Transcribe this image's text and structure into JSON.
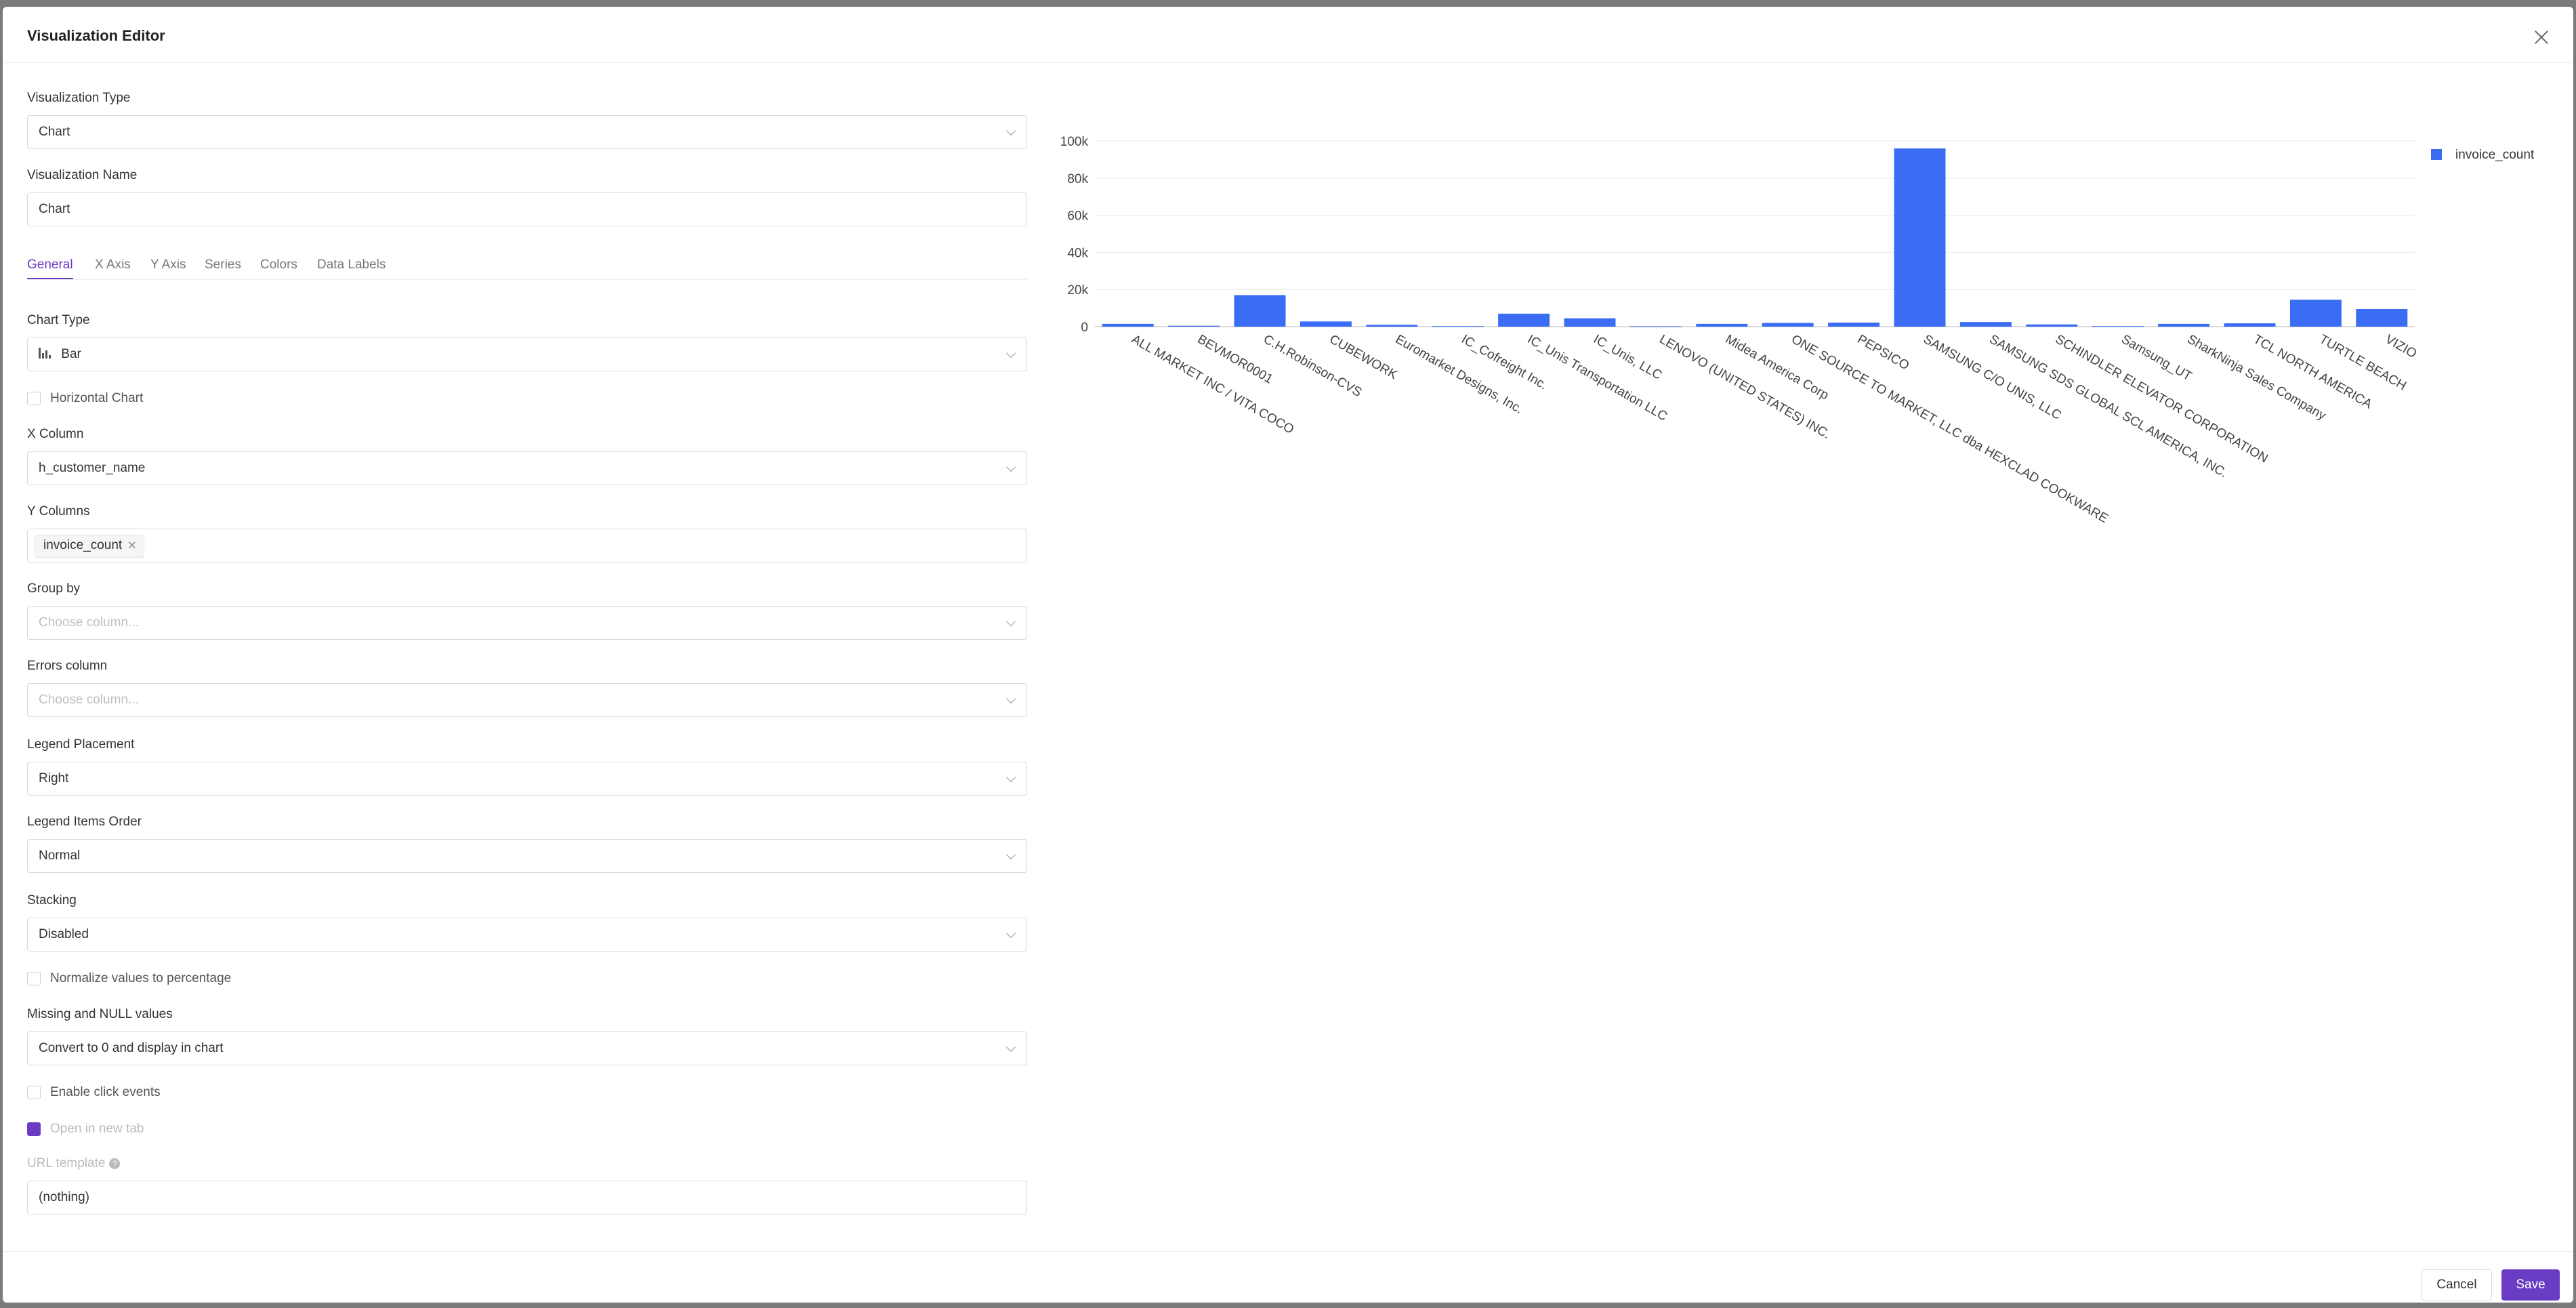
{
  "modal": {
    "title": "Visualization Editor"
  },
  "fields": {
    "viz_type": {
      "label": "Visualization Type",
      "value": "Chart"
    },
    "viz_name": {
      "label": "Visualization Name",
      "value": "Chart"
    }
  },
  "tabs": [
    "General",
    "X Axis",
    "Y Axis",
    "Series",
    "Colors",
    "Data Labels"
  ],
  "general": {
    "chart_type": {
      "label": "Chart Type",
      "value": "Bar"
    },
    "horizontal": {
      "label": "Horizontal Chart",
      "checked": false
    },
    "x_column": {
      "label": "X Column",
      "value": "h_customer_name"
    },
    "y_columns": {
      "label": "Y Columns",
      "tags": [
        "invoice_count"
      ]
    },
    "group_by": {
      "label": "Group by",
      "placeholder": "Choose column..."
    },
    "errors_column": {
      "label": "Errors column",
      "placeholder": "Choose column..."
    },
    "legend_placement": {
      "label": "Legend Placement",
      "value": "Right"
    },
    "legend_order": {
      "label": "Legend Items Order",
      "value": "Normal"
    },
    "stacking": {
      "label": "Stacking",
      "value": "Disabled"
    },
    "normalize": {
      "label": "Normalize values to percentage",
      "checked": false
    },
    "missing_null": {
      "label": "Missing and NULL values",
      "value": "Convert to 0 and display in chart"
    },
    "click_events": {
      "label": "Enable click events",
      "checked": false
    },
    "open_new_tab": {
      "label": "Open in new tab",
      "checked": true
    },
    "url_template": {
      "label": "URL template",
      "value": "(nothing)"
    }
  },
  "footer": {
    "cancel": "Cancel",
    "save": "Save"
  },
  "colors": {
    "accent": "#6a3cc4",
    "bar": "#3b6cf4"
  },
  "chart_data": {
    "type": "bar",
    "categories": [
      "ALL MARKET INC / VITA COCO",
      "BEVMOR0001",
      "C.H.Robinson-CVS",
      "CUBEWORK",
      "Euromarket Designs, Inc.",
      "IC_Cofreight Inc.",
      "IC_Unis Transportation LLC",
      "IC_Unis, LLC",
      "LENOVO (UNITED STATES) INC.",
      "Midea America Corp",
      "ONE SOURCE TO MARKET, LLC dba HEXCLAD COOKWARE",
      "PEPSICO",
      "SAMSUNG C/O UNIS, LLC",
      "SAMSUNG SDS GLOBAL SCL AMERICA, INC.",
      "SCHINDLER ELEVATOR CORPORATION",
      "Samsung_UT",
      "SharkNinja Sales Company",
      "TCL NORTH AMERICA",
      "TURTLE BEACH",
      "VIZIO"
    ],
    "series": [
      {
        "name": "invoice_count",
        "values": [
          1500,
          500,
          17000,
          2800,
          1000,
          300,
          7000,
          4500,
          200,
          1500,
          2000,
          2200,
          96000,
          2500,
          1200,
          300,
          1500,
          1800,
          14500,
          9500
        ]
      }
    ],
    "ylim": [
      0,
      100000
    ],
    "yticks": [
      0,
      20000,
      40000,
      60000,
      80000,
      100000
    ],
    "ytick_labels": [
      "0",
      "20k",
      "40k",
      "60k",
      "80k",
      "100k"
    ],
    "grid": true,
    "legend": "right"
  }
}
